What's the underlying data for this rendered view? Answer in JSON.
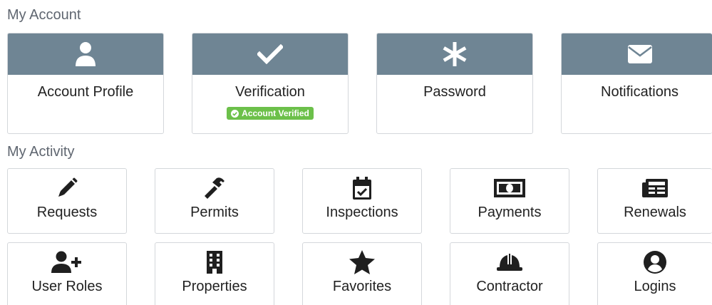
{
  "my_account": {
    "title": "My Account",
    "cards": [
      {
        "label": "Account Profile",
        "icon": "user-icon"
      },
      {
        "label": "Verification",
        "icon": "checkmark-icon",
        "badge": "Account Verified"
      },
      {
        "label": "Password",
        "icon": "asterisk-icon"
      },
      {
        "label": "Notifications",
        "icon": "envelope-icon"
      }
    ]
  },
  "my_activity": {
    "title": "My Activity",
    "cards": [
      {
        "label": "Requests",
        "icon": "pencil-icon"
      },
      {
        "label": "Permits",
        "icon": "hammer-icon"
      },
      {
        "label": "Inspections",
        "icon": "calendar-check-icon"
      },
      {
        "label": "Payments",
        "icon": "money-bill-icon"
      },
      {
        "label": "Renewals",
        "icon": "newspaper-icon"
      },
      {
        "label": "User Roles",
        "icon": "user-plus-icon"
      },
      {
        "label": "Properties",
        "icon": "building-icon"
      },
      {
        "label": "Favorites",
        "icon": "star-icon"
      },
      {
        "label": "Contractor",
        "icon": "hard-hat-icon"
      },
      {
        "label": "Logins",
        "icon": "user-circle-icon"
      }
    ]
  },
  "colors": {
    "card_band": "#6f8594",
    "badge_green": "#6cc04a",
    "section_title": "#5f6670",
    "icon_dark": "#1f1f1f"
  }
}
